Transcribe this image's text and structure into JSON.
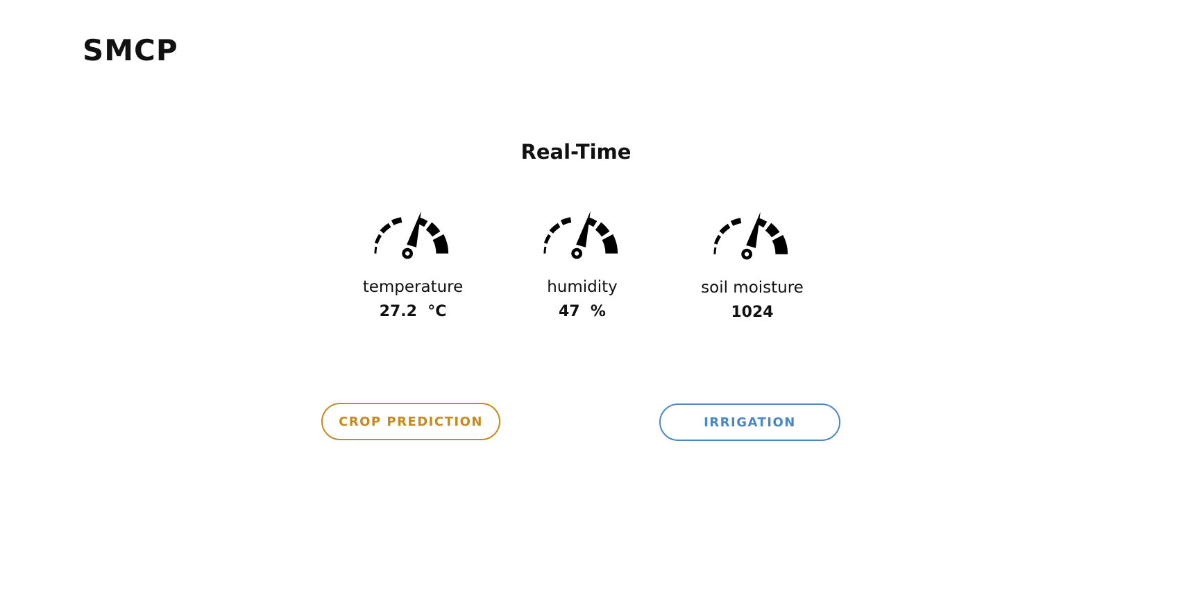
{
  "header": {
    "brand": "SMCP"
  },
  "main": {
    "title": "Real-Time",
    "sensors": [
      {
        "label": "temperature",
        "value": "27.2",
        "unit": "°C",
        "reading": "27.2  °C",
        "icon": "gauge-icon"
      },
      {
        "label": "humidity",
        "value": "47",
        "unit": "%",
        "reading": "47  %",
        "icon": "gauge-icon"
      },
      {
        "label": "soil moisture",
        "value": "1024",
        "unit": "",
        "reading": "1024",
        "icon": "gauge-icon"
      }
    ],
    "actions": {
      "crop_prediction": "CROP PREDICTION",
      "irrigation": "IRRIGATION"
    }
  },
  "colors": {
    "crop_button": "#c9881a",
    "irrigation_button": "#4a86c8",
    "text": "#111111",
    "background": "#ffffff"
  }
}
